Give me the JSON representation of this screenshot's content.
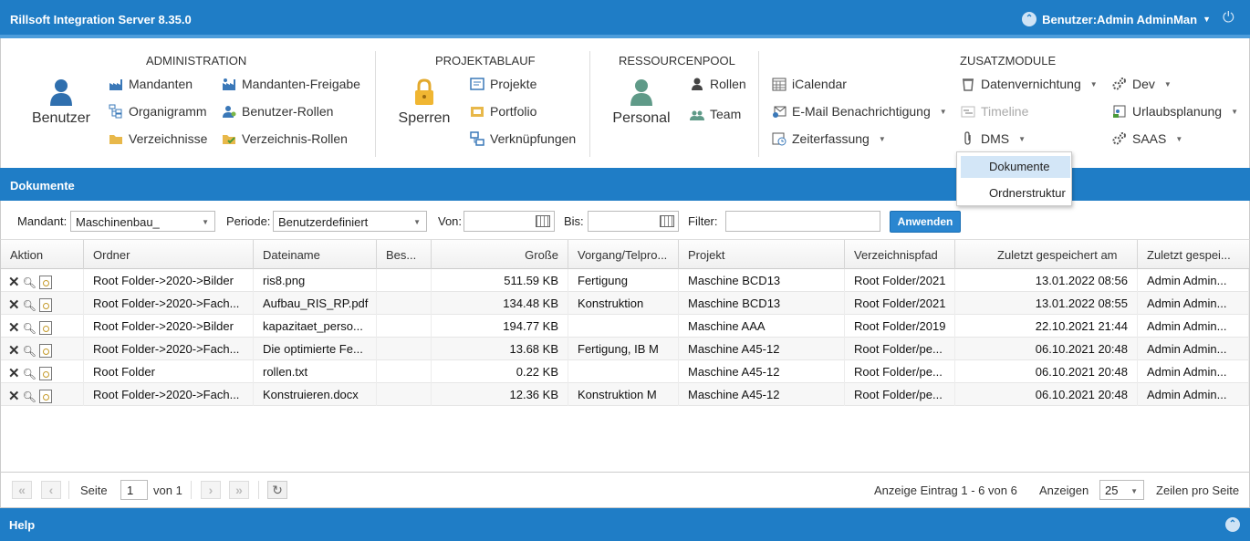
{
  "app": {
    "title": "Rillsoft Integration Server 8.35.0",
    "user": "Benutzer:Admin AdminMan",
    "colors": {
      "primary": "#1f7dc6",
      "selection": "#d3e6f7"
    }
  },
  "ribbon": {
    "administration": {
      "title": "ADMINISTRATION",
      "big": "Benutzer",
      "items": [
        "Mandanten",
        "Organigramm",
        "Verzeichnisse",
        "Mandanten-Freigabe",
        "Benutzer-Rollen",
        "Verzeichnis-Rollen"
      ]
    },
    "projektablauf": {
      "title": "PROJEKTABLAUF",
      "big": "Sperren",
      "items": [
        "Projekte",
        "Portfolio",
        "Verknüpfungen"
      ]
    },
    "ressourcenpool": {
      "title": "RESSOURCENPOOL",
      "big": "Personal",
      "items": [
        "Rollen",
        "Team"
      ]
    },
    "zusatzmodule": {
      "title": "ZUSATZMODULE",
      "items": [
        "iCalendar",
        "E-Mail Benachrichtigung",
        "Zeiterfassung",
        "Datenvernichtung",
        "Timeline",
        "DMS",
        "Dev",
        "Urlaubsplanung",
        "SAAS"
      ]
    }
  },
  "dms_menu": {
    "items": [
      "Dokumente",
      "Ordnerstruktur"
    ],
    "selected": "Dokumente"
  },
  "panel": {
    "title": "Dokumente"
  },
  "filters": {
    "mandant_label": "Mandant:",
    "mandant_value": "Maschinenbau_",
    "periode_label": "Periode:",
    "periode_value": "Benutzerdefiniert",
    "von_label": "Von:",
    "bis_label": "Bis:",
    "filter_label": "Filter:",
    "von_value": "",
    "bis_value": "",
    "filter_value": "",
    "apply_label": "Anwenden"
  },
  "table": {
    "columns": [
      "Aktion",
      "Ordner",
      "Dateiname",
      "Bes...",
      "Große",
      "Vorgang/Telpro...",
      "Projekt",
      "Verzeichnispfad",
      "Zuletzt gespeichert am",
      "Zuletzt gespei..."
    ],
    "rows": [
      [
        "Root Folder->2020->Bilder",
        "ris8.png",
        "",
        "511.59 KB",
        "Fertigung",
        "Maschine BCD13",
        "Root Folder/2021",
        "13.01.2022 08:56",
        "Admin Admin..."
      ],
      [
        "Root Folder->2020->Fach...",
        "Aufbau_RIS_RP.pdf",
        "",
        "134.48 KB",
        "Konstruktion",
        "Maschine BCD13",
        "Root Folder/2021",
        "13.01.2022 08:55",
        "Admin Admin..."
      ],
      [
        "Root Folder->2020->Bilder",
        "kapazitaet_perso...",
        "",
        "194.77 KB",
        "",
        "Maschine AAA",
        "Root Folder/2019",
        "22.10.2021 21:44",
        "Admin Admin..."
      ],
      [
        "Root Folder->2020->Fach...",
        "Die optimierte Fe...",
        "",
        "13.68 KB",
        "Fertigung, IB M",
        "Maschine A45-12",
        "Root Folder/pe...",
        "06.10.2021 20:48",
        "Admin Admin..."
      ],
      [
        "Root Folder",
        "rollen.txt",
        "",
        "0.22 KB",
        "",
        "Maschine A45-12",
        "Root Folder/pe...",
        "06.10.2021 20:48",
        "Admin Admin..."
      ],
      [
        "Root Folder->2020->Fach...",
        "Konstruieren.docx",
        "",
        "12.36 KB",
        "Konstruktion M",
        "Maschine A45-12",
        "Root Folder/pe...",
        "06.10.2021 20:48",
        "Admin Admin..."
      ]
    ]
  },
  "pager": {
    "seite_label": "Seite",
    "page": "1",
    "von_label": "von 1",
    "summary": "Anzeige Eintrag 1 - 6 von 6",
    "anzeigen_label": "Anzeigen",
    "page_size": "25",
    "rows_label": "Zeilen pro Seite"
  },
  "help": {
    "title": "Help"
  }
}
